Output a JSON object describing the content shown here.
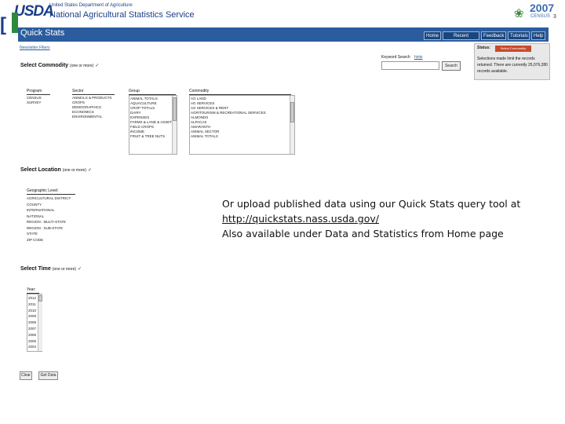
{
  "header": {
    "logo_text": "USDA",
    "dept_text": "United States Department of Agriculture",
    "agency_text": "National Agricultural Statistics Service",
    "census_year": "2007",
    "census_word": "CENSUS",
    "right_edge_mark": "3"
  },
  "navbar": {
    "title": "Quick Stats",
    "items": [
      "Home",
      "Recent Statistics",
      "Feedback",
      "Tutorials",
      "Help"
    ]
  },
  "newsletter_link": "Newsletter Filters",
  "commodity": {
    "title": "Select Commodity",
    "hint": "(one or more)",
    "columns": {
      "program": {
        "label": "Program",
        "items": [
          "CENSUS",
          "SURVEY"
        ]
      },
      "sector": {
        "label": "Sector",
        "items": [
          "ANIMALS & PRODUCTS",
          "CROPS",
          "DEMOGRAPHICS",
          "ECONOMICS",
          "ENVIRONMENTAL"
        ]
      },
      "group": {
        "label": "Group",
        "items": [
          "ANIMAL TOTALS",
          "AQUACULTURE",
          "CROP TOTALS",
          "DAIRY",
          "EXPENSES",
          "FARMS & LAND & ASSETS",
          "FIELD CROPS",
          "INCOME",
          "FRUIT & TREE NUTS"
        ]
      },
      "commodity": {
        "label": "Commodity",
        "items": [
          "AG LAND",
          "AG SERVICES",
          "AG SERVICES & RENT",
          "AGRITOURISM & RECREATIONAL SERVICES",
          "ALMONDS",
          "ALPACAS",
          "AMARANTH",
          "ANIMAL SECTOR",
          "ANIMAL TOTALS"
        ]
      }
    }
  },
  "keyword": {
    "label": "Keyword Search",
    "hints": "hints",
    "placeholder": "",
    "button": "Search"
  },
  "status": {
    "label": "Status:",
    "button": "Select Commodity",
    "text": "Selections made limit the records returned. There are currently 25,076,280 records available."
  },
  "location": {
    "title": "Select Location",
    "hint": "(one or more)",
    "geo_label": "Geographic Level:",
    "items": [
      "AGRICULTURAL DISTRICT",
      "COUNTY",
      "INTERNATIONAL",
      "NATIONAL",
      "REGION : MULTI-STATE",
      "REGION : SUB-STATE",
      "STATE",
      "ZIP CODE"
    ]
  },
  "time": {
    "title": "Select Time",
    "hint": "(one or more)",
    "year_label": "Year:",
    "years": [
      "2012",
      "2011",
      "2010",
      "2009",
      "2008",
      "2007",
      "2006",
      "2005",
      "2004"
    ]
  },
  "buttons": {
    "clear": "Clear",
    "get_data": "Get Data"
  },
  "overlay": {
    "line1": "Or upload published data using our Quick Stats query tool at",
    "link": "http://quickstats.nass.usda.gov/",
    "line3": "Also available under Data and Statistics from Home page"
  }
}
